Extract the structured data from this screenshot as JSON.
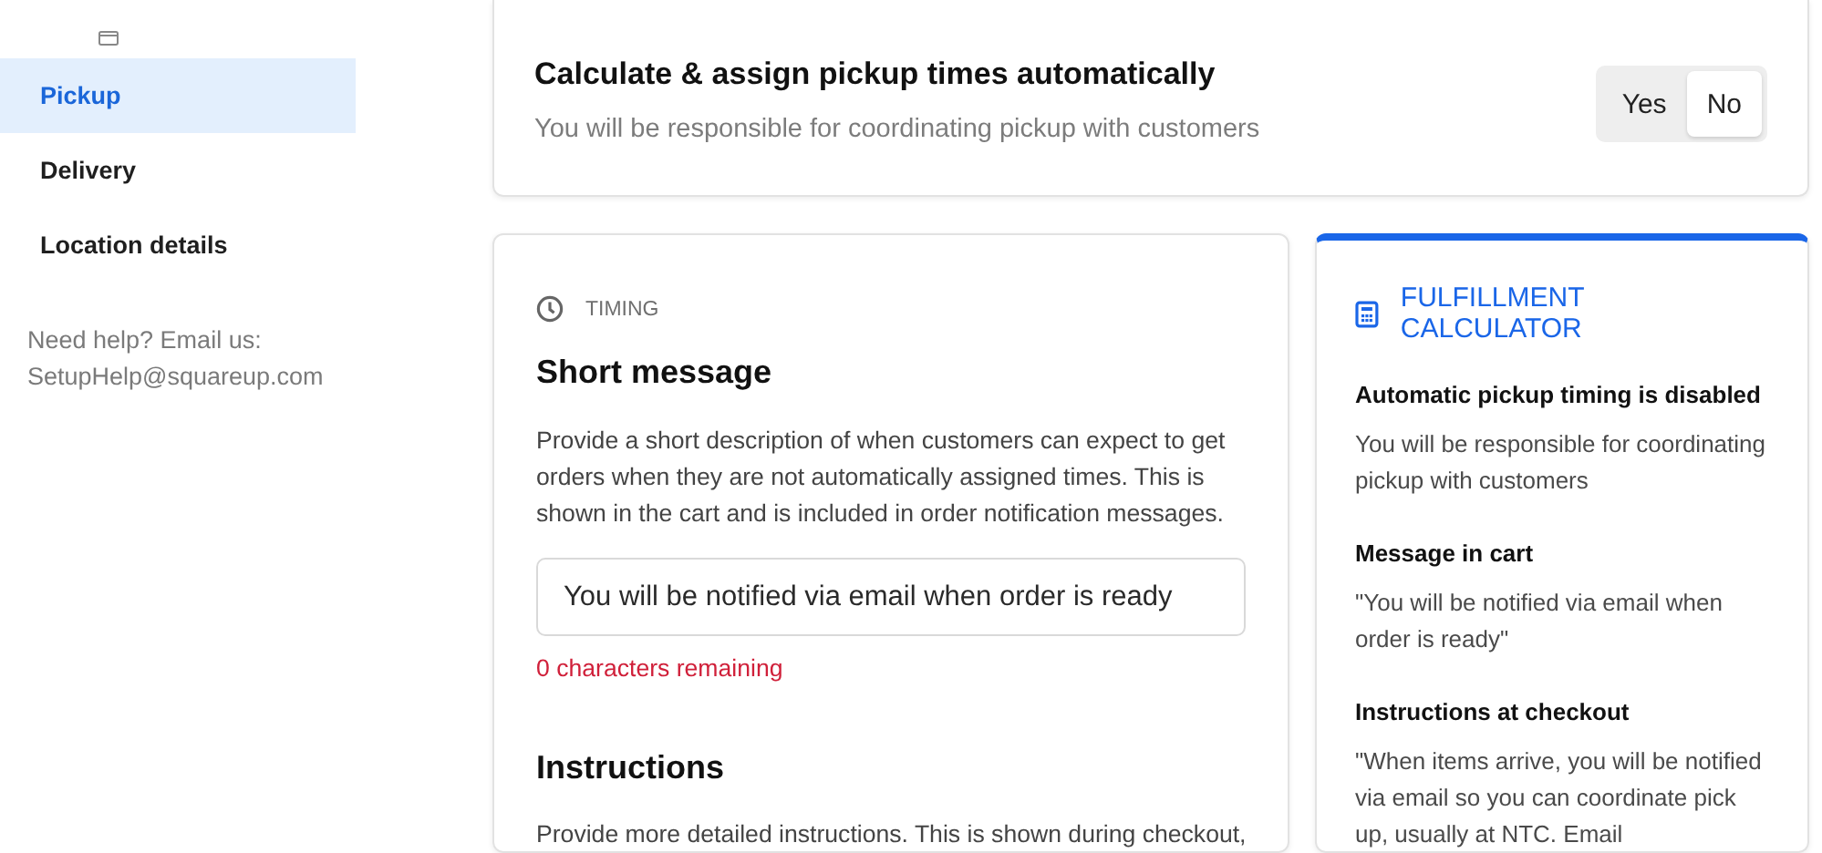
{
  "sidebar": {
    "items": [
      {
        "label": "Pickup",
        "selected": true
      },
      {
        "label": "Delivery",
        "selected": false
      },
      {
        "label": "Location details",
        "selected": false
      }
    ],
    "help": [
      "Need help? Email us:",
      "SetupHelp@squareup.com"
    ]
  },
  "auto_pickup": {
    "title": "Calculate & assign pickup times automatically",
    "subtitle": "You will be responsible for coordinating pickup with customers",
    "options": [
      {
        "label": "Yes",
        "selected": false
      },
      {
        "label": "No",
        "selected": true
      }
    ]
  },
  "timing_card": {
    "section_label": "TIMING",
    "short_message": {
      "title": "Short message",
      "description": "Provide a short description of when customers can expect to get orders when they are not automatically assigned times. This is shown in the cart and is included in order notification messages.",
      "value": "You will be notified via email when order is ready",
      "counter": "0 characters remaining"
    },
    "instructions": {
      "title": "Instructions",
      "description": "Provide more detailed instructions. This is shown during checkout,"
    }
  },
  "calculator": {
    "title": "FULFILLMENT CALCULATOR",
    "sections": [
      {
        "heading": "Automatic pickup timing is disabled",
        "text": "You will be responsible for coordinating pickup with customers"
      },
      {
        "heading": "Message in cart",
        "text": "\"You will be notified via email when order is ready\""
      },
      {
        "heading": "Instructions at checkout",
        "text": "\"When items arrive, you will be notified via email so you can coordinate pick up, usually at NTC. Email"
      }
    ]
  }
}
